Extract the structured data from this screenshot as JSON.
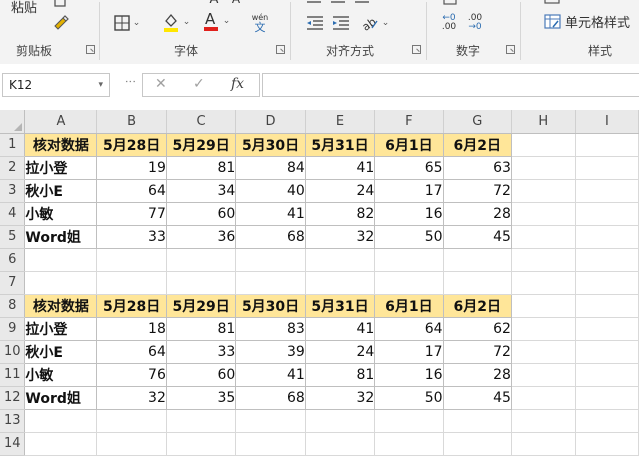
{
  "ribbon": {
    "paste_label": "粘贴",
    "groups": {
      "clipboard": "剪贴板",
      "font": "字体",
      "alignment": "对齐方式",
      "number": "数字",
      "styles": "样式"
    },
    "wen_label": "wén",
    "wen_char": "文",
    "cell_styles_label": "单元格样式",
    "dec_inc": "←0 .00",
    "dec_dec": ".00 →0"
  },
  "formula_bar": {
    "name_box": "K12",
    "cancel_icon": "✕",
    "enter_icon": "✓",
    "fx_label": "fx",
    "formula_value": ""
  },
  "sheet": {
    "columns": [
      "A",
      "B",
      "C",
      "D",
      "E",
      "F",
      "G",
      "H",
      "I"
    ],
    "rows": [
      [
        "核对数据",
        "5月28日",
        "5月29日",
        "5月30日",
        "5月31日",
        "6月1日",
        "6月2日",
        "",
        ""
      ],
      [
        "拉小登",
        "19",
        "81",
        "84",
        "41",
        "65",
        "63",
        "",
        ""
      ],
      [
        "秋小E",
        "64",
        "34",
        "40",
        "24",
        "17",
        "72",
        "",
        ""
      ],
      [
        "小敏",
        "77",
        "60",
        "41",
        "82",
        "16",
        "28",
        "",
        ""
      ],
      [
        "Word姐",
        "33",
        "36",
        "68",
        "32",
        "50",
        "45",
        "",
        ""
      ],
      [
        "",
        "",
        "",
        "",
        "",
        "",
        "",
        "",
        ""
      ],
      [
        "",
        "",
        "",
        "",
        "",
        "",
        "",
        "",
        ""
      ],
      [
        "核对数据",
        "5月28日",
        "5月29日",
        "5月30日",
        "5月31日",
        "6月1日",
        "6月2日",
        "",
        ""
      ],
      [
        "拉小登",
        "18",
        "81",
        "83",
        "41",
        "64",
        "62",
        "",
        ""
      ],
      [
        "秋小E",
        "64",
        "33",
        "39",
        "24",
        "17",
        "72",
        "",
        ""
      ],
      [
        "小敏",
        "76",
        "60",
        "41",
        "81",
        "16",
        "28",
        "",
        ""
      ],
      [
        "Word姐",
        "32",
        "35",
        "68",
        "32",
        "50",
        "45",
        "",
        ""
      ],
      [
        "",
        "",
        "",
        "",
        "",
        "",
        "",
        "",
        ""
      ],
      [
        "",
        "",
        "",
        "",
        "",
        "",
        "",
        "",
        ""
      ]
    ],
    "header_fill": "#ffe699"
  }
}
